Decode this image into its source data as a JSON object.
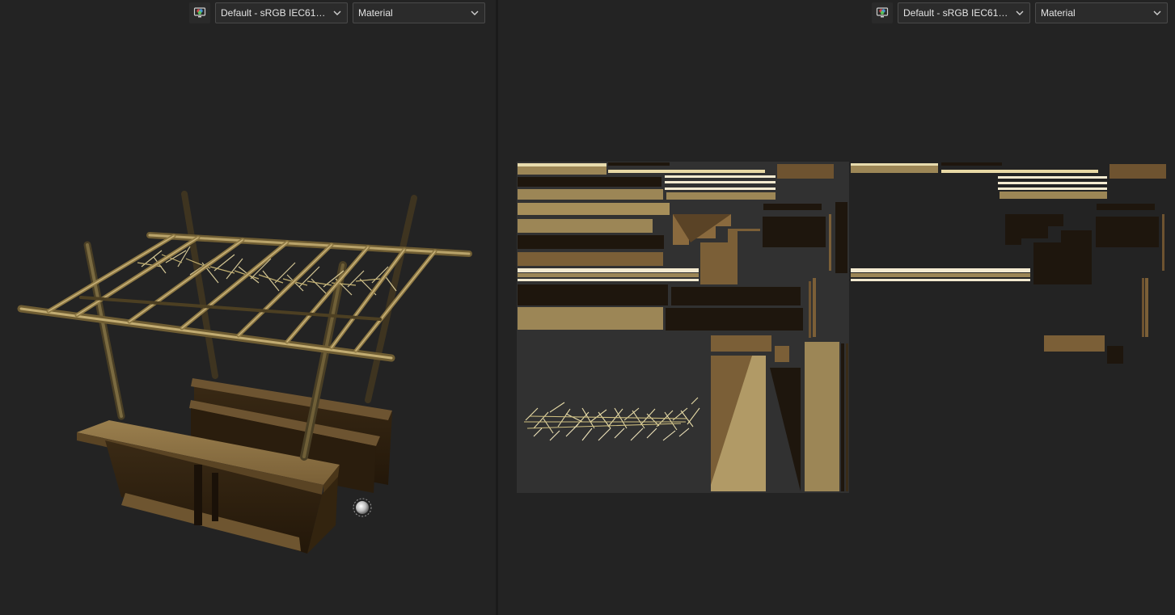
{
  "left_panel": {
    "toolbar": {
      "display_icon": "monitor-color-icon",
      "colorspace_value": "Default - sRGB IEC61966-2.",
      "channel_value": "Material"
    },
    "light_gizmo": "light-sphere-icon"
  },
  "right_panel": {
    "toolbar": {
      "display_icon": "monitor-color-icon",
      "colorspace_value": "Default - sRGB IEC61966-2.",
      "channel_value": "Material"
    }
  },
  "colors": {
    "background": "#232323",
    "uv_tile": "#313131",
    "wood_light": "#9c8656",
    "wood_mid": "#6e5330",
    "wood_dark": "#1e160d",
    "straw": "#e6d7a0"
  }
}
